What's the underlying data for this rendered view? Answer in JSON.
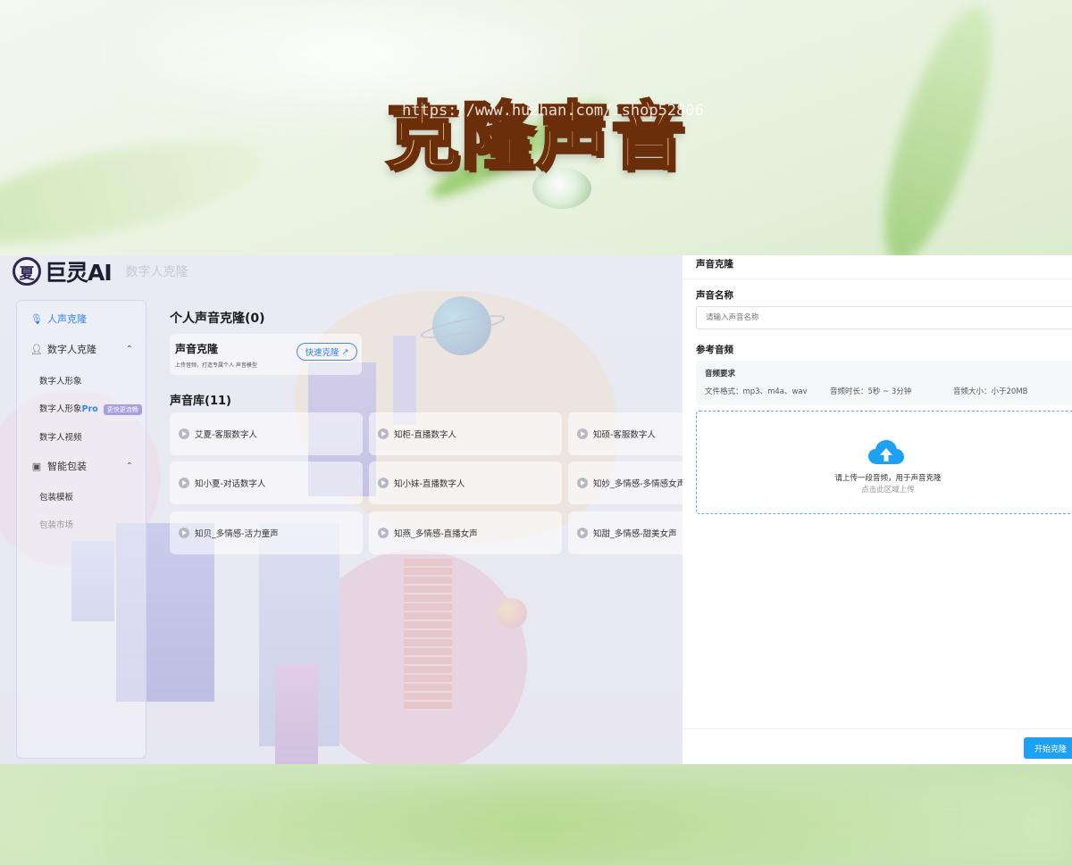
{
  "banner": {
    "title": "克隆声音",
    "watermark": "https://www.huzhan.com/ishop52806"
  },
  "app": {
    "logo_mark": "夏",
    "logo_text": "巨灵AI",
    "logo_sub": "数字人克隆"
  },
  "sidebar": {
    "voice_clone": "人声克隆",
    "digital_clone": "数字人克隆",
    "digital_items": [
      {
        "label": "数字人形象"
      },
      {
        "label": "数字人形象",
        "suffix": "Pro",
        "tag": "更快更流畅"
      },
      {
        "label": "数字人视频"
      }
    ],
    "smart_pack": "智能包装",
    "pack_items": [
      {
        "label": "包装模板"
      },
      {
        "label": "包装市场"
      }
    ]
  },
  "main": {
    "personal_title": "个人声音克隆(0)",
    "clone_card": {
      "title": "声音克隆",
      "desc": "上传音频，打造专属个人 声音模型",
      "button": "快速克隆"
    },
    "library_title": "声音库(11)",
    "voices": [
      "艾夏-客服数字人",
      "知柜-直播数字人",
      "知硕-客服数字人",
      "知小夏-对话数字人",
      "知小妹-直播数字人",
      "知妙_多情感-多情感女声",
      "知贝_多情感-活力童声",
      "知燕_多情感-直播女声",
      "知甜_多情感-甜美女声"
    ]
  },
  "drawer": {
    "header": "声音克隆",
    "name_label": "声音名称",
    "name_placeholder": "请输入声音名称",
    "ref_label": "参考音频",
    "req_title": "音频要求",
    "req_format": "文件格式：mp3、m4a、wav",
    "req_duration": "音频时长：5秒 ~ 3分钟",
    "req_size": "音频大小：小于20MB",
    "upload_main": "请上传一段音频，用于声音克隆",
    "upload_sub": "点击此区域上传",
    "start_button": "开始克隆"
  },
  "colors": {
    "accent": "#1ea1f4",
    "link_blue": "#2f86f6",
    "title_fill": "#ffd88a",
    "title_stroke": "#6b2e0a"
  }
}
